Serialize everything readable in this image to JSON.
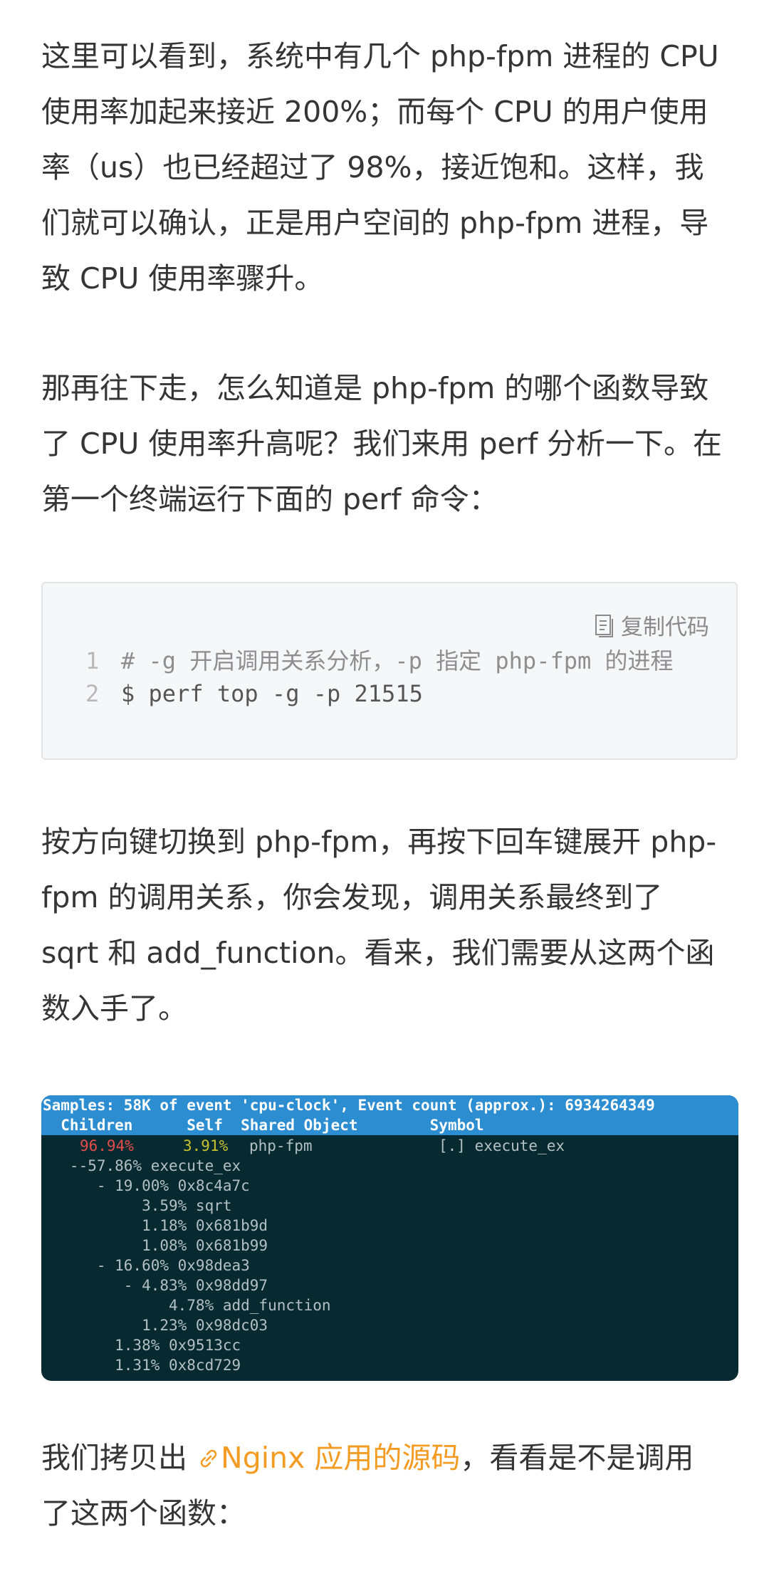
{
  "paragraphs": {
    "p1": [
      "这里可以看到，系统中有几个 php-fpm 进程的 CPU",
      "使用率加起来接近 200%；而每个 CPU 的用户使用",
      "率（us）也已经超过了 98%，接近饱和。这样，我",
      "们就可以确认，正是用户空间的 php-fpm 进程，导",
      "致 CPU 使用率骤升。"
    ],
    "p2": [
      "那再往下走，怎么知道是 php-fpm 的哪个函数导致",
      "了 CPU 使用率升高呢？我们来用 perf 分析一下。在",
      "第一个终端运行下面的 perf 命令："
    ],
    "p3": [
      "按方向键切换到 php-fpm，再按下回车键展开 php-",
      "fpm 的调用关系，你会发现，调用关系最终到了",
      "sqrt 和 add_function。看来，我们需要从这两个函",
      "数入手了。"
    ],
    "p4": {
      "before": "我们拷贝出 ",
      "link": "Nginx 应用的源码",
      "after": "，看看是不是调用",
      "line2": "了这两个函数："
    }
  },
  "code": {
    "copy_label": "复制代码",
    "lines": [
      {
        "num": "1",
        "text": "# -g 开启调用关系分析，-p 指定 php-fpm 的进程",
        "kind": "comment"
      },
      {
        "num": "2",
        "text": "$ perf top -g -p 21515",
        "kind": "command"
      }
    ]
  },
  "terminal": {
    "header1": "Samples: 58K of event 'cpu-clock', Event count (approx.): 6934264349",
    "header2": "  Children      Self  Shared Object        Symbol",
    "row0": {
      "dash": "-",
      "children": "96.94%",
      "self": "3.91%",
      "object": "php-fpm",
      "symbol": "[.] execute_ex"
    },
    "tree": [
      "   - 57.86% execute_ex",
      "      - 19.00% 0x8c4a7c",
      "           3.59% sqrt",
      "           1.18% 0x681b9d",
      "           1.08% 0x681b99",
      "      - 16.60% 0x98dea3",
      "         - 4.83% 0x98dd97",
      "              4.78% add_function",
      "           1.23% 0x98dc03",
      "        1.38% 0x9513cc",
      "        1.31% 0x8cd729"
    ],
    "colors": {
      "header_bg": "#2d8dd1",
      "bg": "#062a30",
      "children_pct": "#e84c4c",
      "self_pct": "#c9c22c"
    }
  },
  "colors": {
    "link": "#f39c24",
    "text": "#353535"
  }
}
